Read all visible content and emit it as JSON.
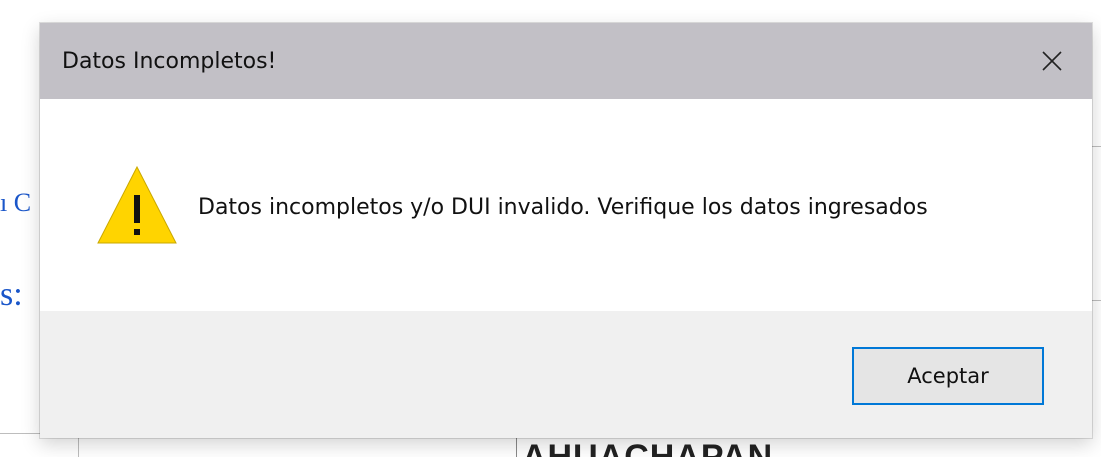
{
  "background": {
    "text_fragment_1": "ı C",
    "text_fragment_2": "s:",
    "bottom_text": "AHUACHAPAN"
  },
  "dialog": {
    "title": "Datos Incompletos!",
    "close_icon": "close-icon",
    "message_icon": "warning-icon",
    "message": "Datos incompletos y/o DUI invalido. Verifique los datos ingresados",
    "ok_label": "Aceptar"
  },
  "colors": {
    "titlebar": "#c2c0c6",
    "warning_fill": "#ffd400",
    "button_border": "#0078d7",
    "background_link_text": "#1a56c9"
  }
}
